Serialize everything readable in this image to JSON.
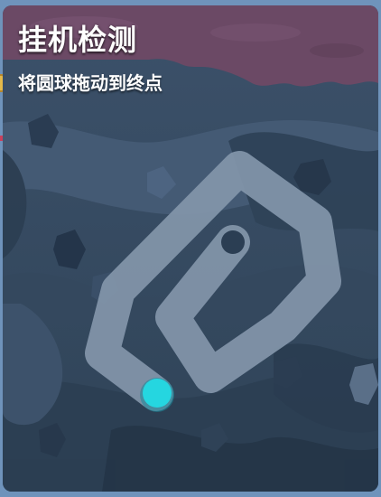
{
  "dialog": {
    "title": "挂机检测",
    "instruction": "将圆球拖动到终点"
  },
  "puzzle": {
    "ball_color": "#25d6e0",
    "track_color": "#8295a9",
    "end_marker_color": "#2b3e53",
    "banner_color": "#6b4965"
  },
  "icons": {
    "side_item": "coin-icon"
  }
}
